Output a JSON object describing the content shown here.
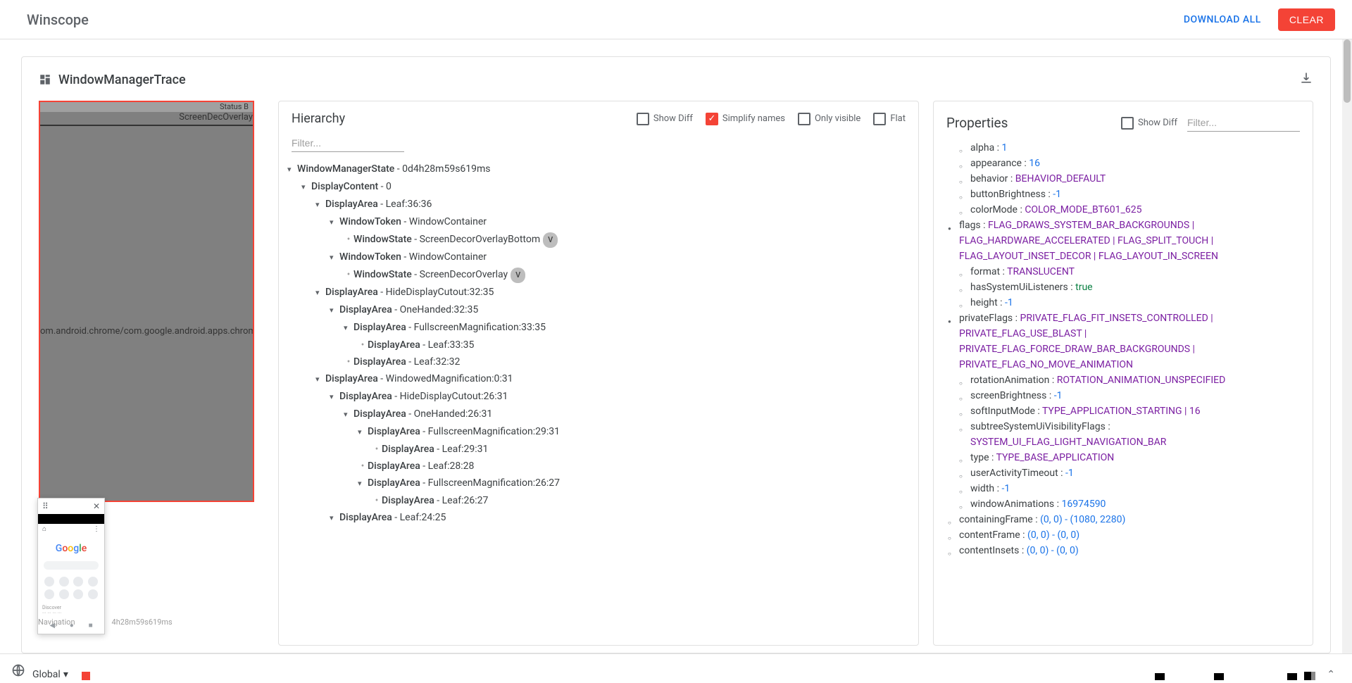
{
  "header": {
    "title": "Winscope",
    "download_all": "DOWNLOAD ALL",
    "clear": "CLEAR"
  },
  "trace": {
    "title": "WindowManagerTrace"
  },
  "preview": {
    "status_label": "Status B",
    "overlay_label": "ScreenDecOverlay",
    "activity_label": "om.android.chrome/com.google.android.apps.chrome.Main"
  },
  "hierarchy": {
    "title": "Hierarchy",
    "show_diff": "Show Diff",
    "simplify": "Simplify names",
    "only_visible": "Only visible",
    "flat": "Flat",
    "filter_placeholder": "Filter...",
    "nodes": [
      {
        "depth": 0,
        "arrow": true,
        "bold": "WindowManagerState",
        "rest": " - 0d4h28m59s619ms"
      },
      {
        "depth": 1,
        "arrow": true,
        "bold": "DisplayContent",
        "rest": " - 0"
      },
      {
        "depth": 2,
        "arrow": true,
        "bold": "DisplayArea",
        "rest": " - Leaf:36:36"
      },
      {
        "depth": 3,
        "arrow": true,
        "bold": "WindowToken",
        "rest": " - WindowContainer"
      },
      {
        "depth": 4,
        "bullet": true,
        "bold": "WindowState",
        "rest": " - ScreenDecorOverlayBottom",
        "badge": "V"
      },
      {
        "depth": 3,
        "arrow": true,
        "bold": "WindowToken",
        "rest": " - WindowContainer"
      },
      {
        "depth": 4,
        "bullet": true,
        "bold": "WindowState",
        "rest": " - ScreenDecorOverlay",
        "badge": "V"
      },
      {
        "depth": 2,
        "arrow": true,
        "bold": "DisplayArea",
        "rest": " - HideDisplayCutout:32:35"
      },
      {
        "depth": 3,
        "arrow": true,
        "bold": "DisplayArea",
        "rest": " - OneHanded:32:35"
      },
      {
        "depth": 4,
        "arrow": true,
        "bold": "DisplayArea",
        "rest": " - FullscreenMagnification:33:35"
      },
      {
        "depth": 5,
        "bullet": true,
        "bold": "DisplayArea",
        "rest": " - Leaf:33:35"
      },
      {
        "depth": 4,
        "bullet": true,
        "bold": "DisplayArea",
        "rest": " - Leaf:32:32"
      },
      {
        "depth": 2,
        "arrow": true,
        "bold": "DisplayArea",
        "rest": " - WindowedMagnification:0:31"
      },
      {
        "depth": 3,
        "arrow": true,
        "bold": "DisplayArea",
        "rest": " - HideDisplayCutout:26:31"
      },
      {
        "depth": 4,
        "arrow": true,
        "bold": "DisplayArea",
        "rest": " - OneHanded:26:31"
      },
      {
        "depth": 5,
        "arrow": true,
        "bold": "DisplayArea",
        "rest": " - FullscreenMagnification:29:31"
      },
      {
        "depth": 6,
        "bullet": true,
        "bold": "DisplayArea",
        "rest": " - Leaf:29:31"
      },
      {
        "depth": 5,
        "bullet": true,
        "bold": "DisplayArea",
        "rest": " - Leaf:28:28"
      },
      {
        "depth": 5,
        "arrow": true,
        "bold": "DisplayArea",
        "rest": " - FullscreenMagnification:26:27"
      },
      {
        "depth": 6,
        "bullet": true,
        "bold": "DisplayArea",
        "rest": " - Leaf:26:27"
      },
      {
        "depth": 3,
        "arrow": true,
        "bold": "DisplayArea",
        "rest": " - Leaf:24:25"
      }
    ]
  },
  "properties": {
    "title": "Properties",
    "show_diff": "Show Diff",
    "filter_placeholder": "Filter...",
    "rows": [
      {
        "indent": 1,
        "dot": "hollow",
        "key": "alpha",
        "val": "1",
        "cls": "prop-val"
      },
      {
        "indent": 1,
        "dot": "hollow",
        "key": "appearance",
        "val": "16",
        "cls": "prop-val"
      },
      {
        "indent": 1,
        "dot": "hollow",
        "key": "behavior",
        "val": "BEHAVIOR_DEFAULT",
        "cls": "purple"
      },
      {
        "indent": 1,
        "dot": "hollow",
        "key": "buttonBrightness",
        "val": "-1",
        "cls": "prop-val"
      },
      {
        "indent": 1,
        "dot": "hollow",
        "key": "colorMode",
        "val": "COLOR_MODE_BT601_625",
        "cls": "purple"
      },
      {
        "indent": 0,
        "dot": "solid",
        "key": "flags",
        "val": "FLAG_DRAWS_SYSTEM_BAR_BACKGROUNDS | FLAG_HARDWARE_ACCELERATED | FLAG_SPLIT_TOUCH | FLAG_LAYOUT_INSET_DECOR | FLAG_LAYOUT_IN_SCREEN",
        "cls": "purple"
      },
      {
        "indent": 1,
        "dot": "hollow",
        "key": "format",
        "val": "TRANSLUCENT",
        "cls": "purple"
      },
      {
        "indent": 1,
        "dot": "hollow",
        "key": "hasSystemUiListeners",
        "val": "true",
        "cls": "green"
      },
      {
        "indent": 1,
        "dot": "hollow",
        "key": "height",
        "val": "-1",
        "cls": "prop-val"
      },
      {
        "indent": 0,
        "dot": "solid",
        "key": "privateFlags",
        "val": "PRIVATE_FLAG_FIT_INSETS_CONTROLLED | PRIVATE_FLAG_USE_BLAST | PRIVATE_FLAG_FORCE_DRAW_BAR_BACKGROUNDS | PRIVATE_FLAG_NO_MOVE_ANIMATION",
        "cls": "purple"
      },
      {
        "indent": 1,
        "dot": "hollow",
        "key": "rotationAnimation",
        "val": "ROTATION_ANIMATION_UNSPECIFIED",
        "cls": "purple"
      },
      {
        "indent": 1,
        "dot": "hollow",
        "key": "screenBrightness",
        "val": "-1",
        "cls": "prop-val"
      },
      {
        "indent": 1,
        "dot": "hollow",
        "key": "softInputMode",
        "val": "TYPE_APPLICATION_STARTING | 16",
        "cls": "purple"
      },
      {
        "indent": 1,
        "dot": "hollow",
        "key": "subtreeSystemUiVisibilityFlags",
        "val": "SYSTEM_UI_FLAG_LIGHT_NAVIGATION_BAR",
        "cls": "purple"
      },
      {
        "indent": 1,
        "dot": "hollow",
        "key": "type",
        "val": "TYPE_BASE_APPLICATION",
        "cls": "purple"
      },
      {
        "indent": 1,
        "dot": "hollow",
        "key": "userActivityTimeout",
        "val": "-1",
        "cls": "prop-val"
      },
      {
        "indent": 1,
        "dot": "hollow",
        "key": "width",
        "val": "-1",
        "cls": "prop-val"
      },
      {
        "indent": 1,
        "dot": "hollow",
        "key": "windowAnimations",
        "val": "16974590",
        "cls": "prop-val"
      },
      {
        "indent": 0,
        "dot": "hollow",
        "key": "containingFrame",
        "val": "(0, 0) - (1080, 2280)",
        "cls": "prop-val"
      },
      {
        "indent": 0,
        "dot": "hollow",
        "key": "contentFrame",
        "val": "(0, 0) - (0, 0)",
        "cls": "prop-val"
      },
      {
        "indent": 0,
        "dot": "hollow",
        "key": "contentInsets",
        "val": "(0, 0) - (0, 0)",
        "cls": "prop-val"
      }
    ]
  },
  "bottom": {
    "nav_label": "Navigation",
    "ts_label": "4h28m59s619ms",
    "global": "Global"
  }
}
